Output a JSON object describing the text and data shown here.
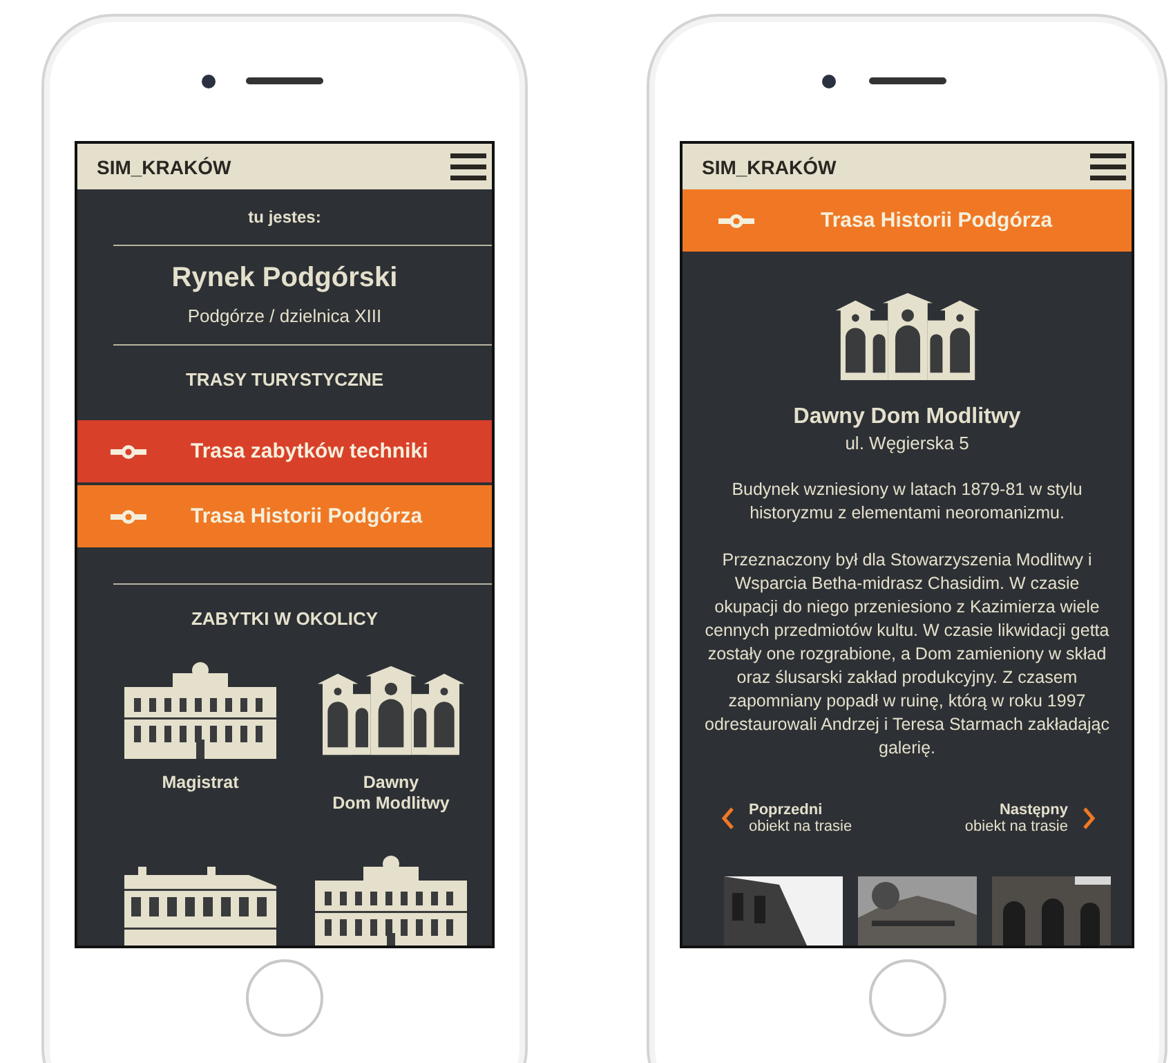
{
  "left_screen": {
    "app_title": "SIM_KRAKÓW",
    "location_label": "tu jestes:",
    "location_name": "Rynek Podgórski",
    "district": "Podgórze / dzielnica XIII",
    "routes_heading": "TRASY TURYSTYCZNE",
    "routes": [
      {
        "name": "Trasa zabytków techniki",
        "color": "#d9402a"
      },
      {
        "name": "Trasa Historii Podgórza",
        "color": "#f07824"
      }
    ],
    "sights_heading": "ZABYTKI W OKOLICY",
    "sights": [
      {
        "kind": "hall",
        "name": "Magistrat"
      },
      {
        "kind": "temple",
        "name": "Dawny\nDom Modlitwy"
      },
      {
        "kind": "villa"
      },
      {
        "kind": "hall"
      }
    ]
  },
  "right_screen": {
    "app_title": "SIM_KRAKÓW",
    "route": {
      "name": "Trasa Historii Podgórza",
      "color": "#f07824"
    },
    "building": {
      "kind": "temple"
    },
    "sight_name": "Dawny Dom Modlitwy",
    "address": "ul. Węgierska 5",
    "paragraphs": [
      "Budynek wzniesiony w latach 1879-81 w stylu historyzmu z elementami neoromanizmu.",
      "Przeznaczony był dla Stowarzyszenia Modlitwy i Wsparcia Betha-midrasz Chasidim. W czasie okupacji do niego przeniesiono z Kazimierza wiele cennych przedmiotów kultu. W czasie likwidacji getta zostały one rozgrabione, a Dom zamieniony w skład oraz ślusarski zakład produkcyjny. Z czasem zapomniany popadł w ruinę, którą w roku 1997 odrestaurowali Andrzej i Teresa Starmach zakładając galerię."
    ],
    "prev": {
      "title": "Poprzedni",
      "subtitle": "obiekt na trasie"
    },
    "next": {
      "title": "Następny",
      "subtitle": "obiekt na trasie"
    },
    "photos": [
      {
        "kind": "picture"
      },
      {
        "kind": "picture"
      },
      {
        "kind": "picture"
      }
    ]
  }
}
